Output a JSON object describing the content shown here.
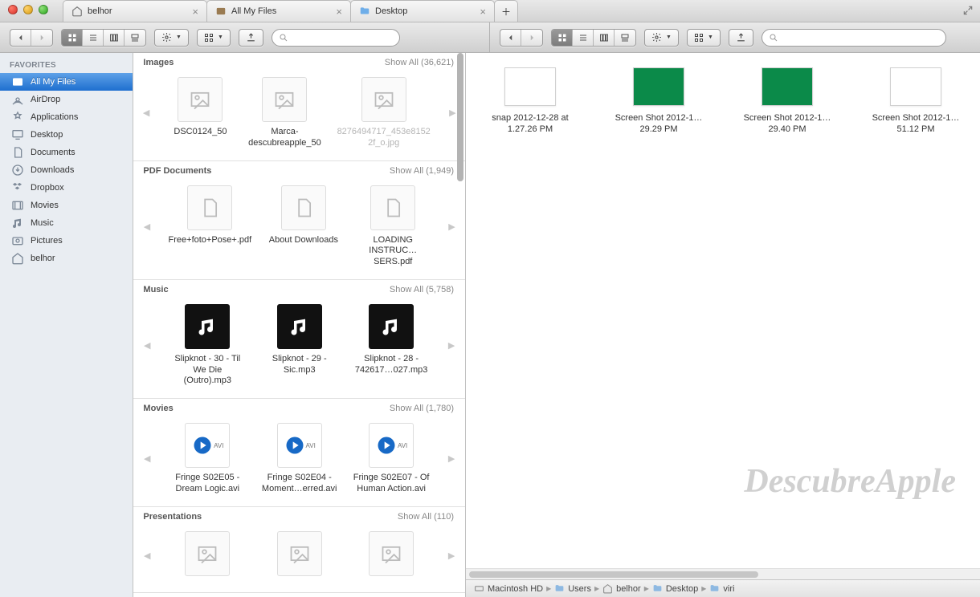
{
  "tabs": [
    {
      "icon": "home",
      "label": "belhor"
    },
    {
      "icon": "allfiles",
      "label": "All My Files"
    },
    {
      "icon": "folder",
      "label": "Desktop"
    }
  ],
  "sidebar": {
    "header": "FAVORITES",
    "items": [
      {
        "icon": "allfiles",
        "label": "All My Files",
        "active": true
      },
      {
        "icon": "airdrop",
        "label": "AirDrop"
      },
      {
        "icon": "apps",
        "label": "Applications"
      },
      {
        "icon": "desktop",
        "label": "Desktop"
      },
      {
        "icon": "docs",
        "label": "Documents"
      },
      {
        "icon": "dl",
        "label": "Downloads"
      },
      {
        "icon": "dropbox",
        "label": "Dropbox"
      },
      {
        "icon": "movies",
        "label": "Movies"
      },
      {
        "icon": "music",
        "label": "Music"
      },
      {
        "icon": "pics",
        "label": "Pictures"
      },
      {
        "icon": "home",
        "label": "belhor"
      }
    ]
  },
  "search_placeholder": "",
  "center": {
    "cats": [
      {
        "name": "Images",
        "count": "36,621",
        "showall": "Show All",
        "items": [
          {
            "label": "DSC0124_50"
          },
          {
            "label": "Marca-descubreapple_50"
          },
          {
            "label": "8276494717_453e81522f_o.jpg",
            "dim": true
          }
        ]
      },
      {
        "name": "PDF Documents",
        "count": "1,949",
        "showall": "Show All",
        "items": [
          {
            "label": "Free+foto+Pose+.pdf"
          },
          {
            "label": "About Downloads"
          },
          {
            "label": "LOADING INSTRUC…SERS.pdf"
          }
        ]
      },
      {
        "name": "Music",
        "count": "5,758",
        "showall": "Show All",
        "items": [
          {
            "label": "Slipknot - 30 - Til We Die (Outro).mp3"
          },
          {
            "label": "Slipknot - 29 - Sic.mp3"
          },
          {
            "label": "Slipknot - 28 - 742617…027.mp3"
          }
        ]
      },
      {
        "name": "Movies",
        "count": "1,780",
        "showall": "Show All",
        "items": [
          {
            "label": "Fringe S02E05 - Dream Logic.avi"
          },
          {
            "label": "Fringe S02E04 - Moment…erred.avi"
          },
          {
            "label": "Fringe S02E07 - Of Human Action.avi"
          }
        ]
      },
      {
        "name": "Presentations",
        "count": "110",
        "showall": "Show All",
        "items": [
          {
            "label": ""
          },
          {
            "label": ""
          },
          {
            "label": ""
          }
        ]
      }
    ]
  },
  "desktop": {
    "items": [
      {
        "label": "snap 2012-12-28 at 1.27.26 PM",
        "kind": "shot"
      },
      {
        "label": "Screen Shot 2012-1…29.29 PM",
        "kind": "green"
      },
      {
        "label": "Screen Shot 2012-1…29.40 PM",
        "kind": "green"
      },
      {
        "label": "Screen Shot 2012-1…51.12 PM",
        "kind": "shot"
      }
    ]
  },
  "pathbar": [
    "Macintosh HD",
    "Users",
    "belhor",
    "Desktop",
    "viri"
  ],
  "pathicons": [
    "disk",
    "folder",
    "home",
    "folder",
    "folder"
  ],
  "watermark": "DescubreApple"
}
